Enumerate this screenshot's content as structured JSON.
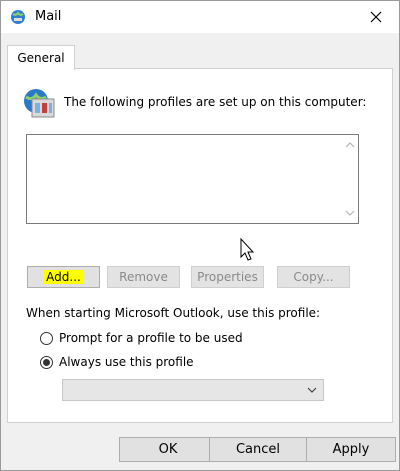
{
  "window": {
    "title": "Mail",
    "icon": "mail-globe-icon"
  },
  "tabs": [
    {
      "label": "General",
      "selected": true
    }
  ],
  "general": {
    "intro_text": "The following profiles are set up on this computer:",
    "profiles": [],
    "buttons": {
      "add": "Add...",
      "remove": "Remove",
      "properties": "Properties",
      "copy": "Copy..."
    },
    "startup_text": "When starting Microsoft Outlook, use this profile:",
    "radio_prompt": "Prompt for a profile to be used",
    "radio_always": "Always use this profile",
    "selected_option": "always",
    "profile_select_value": ""
  },
  "footer": {
    "ok": "OK",
    "cancel": "Cancel",
    "apply": "Apply"
  },
  "colors": {
    "highlight": "#ffff00",
    "panel": "#ffffff",
    "dialog_bg": "#f0f0f0"
  }
}
